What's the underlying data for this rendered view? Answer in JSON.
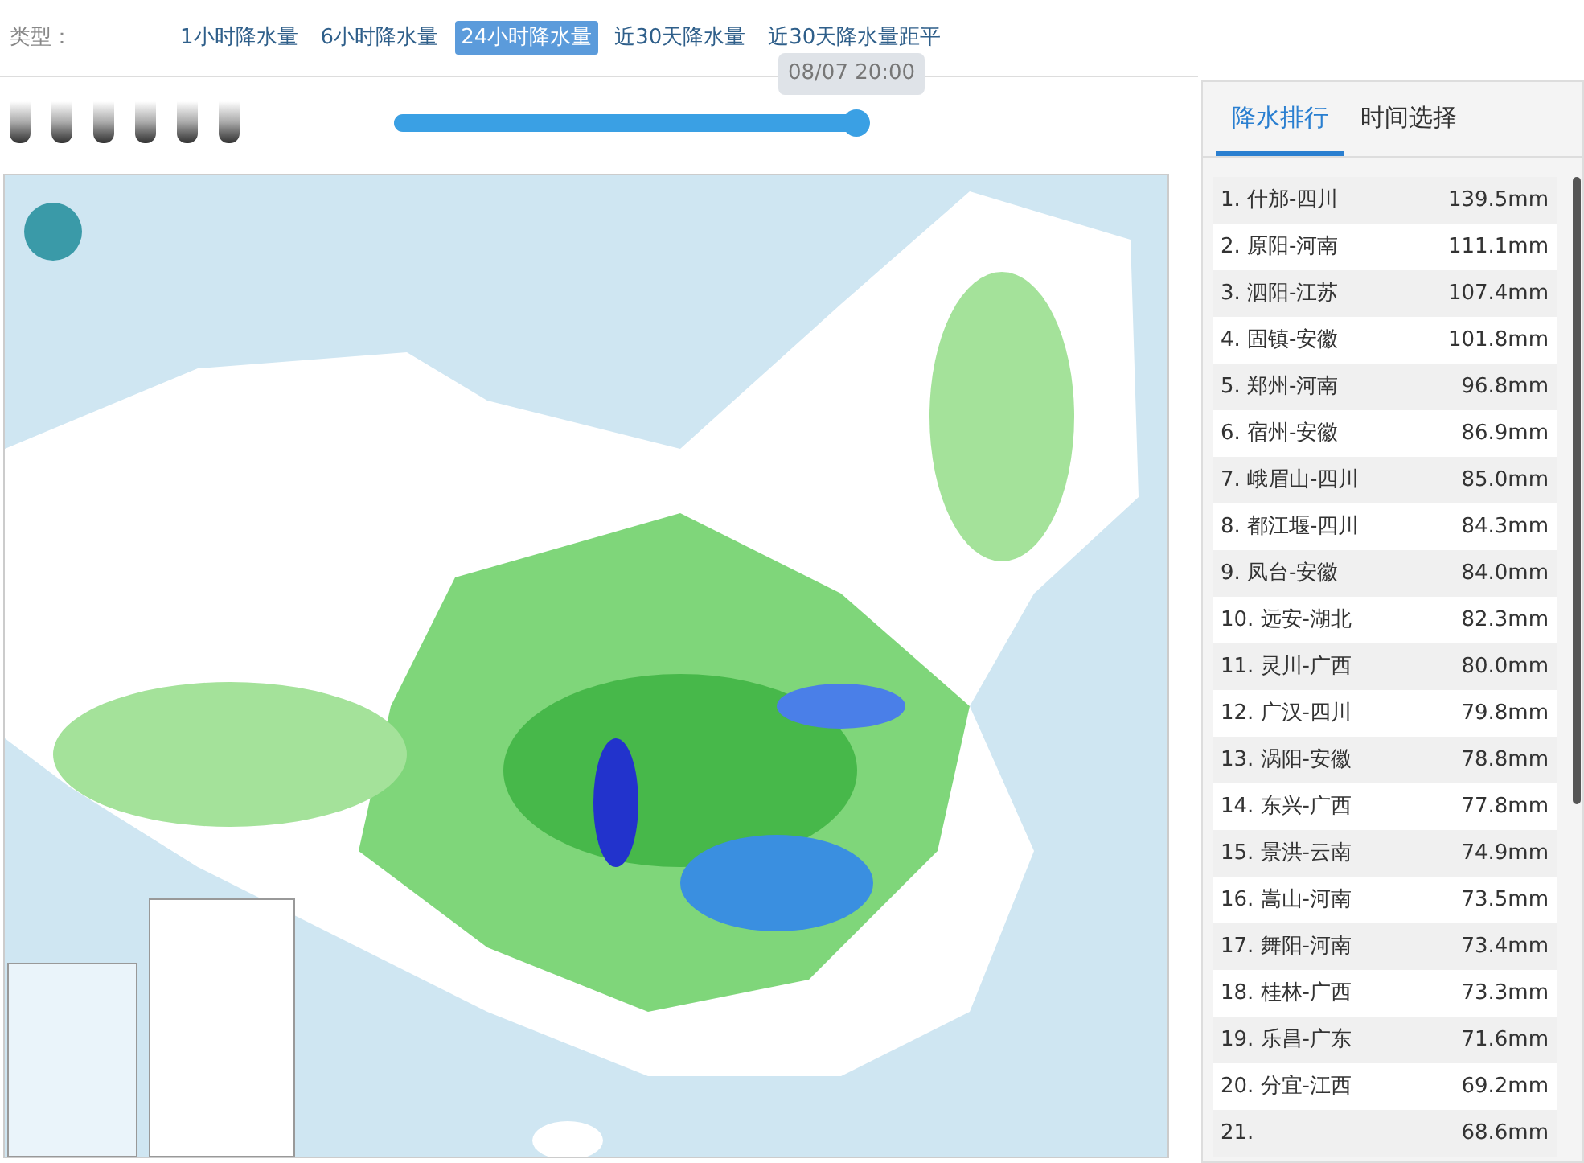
{
  "filter": {
    "label": "类型：",
    "tabs": [
      {
        "label": "1小时降水量",
        "selected": false
      },
      {
        "label": "6小时降水量",
        "selected": false
      },
      {
        "label": "24小时降水量",
        "selected": true
      },
      {
        "label": "近30天降水量",
        "selected": false
      },
      {
        "label": "近30天降水量距平",
        "selected": false
      }
    ]
  },
  "timeline": {
    "tooltip": "08/07 20:00",
    "level": 1
  },
  "panel": {
    "tabs": [
      {
        "label": "降水排行",
        "selected": true
      },
      {
        "label": "时间选择",
        "selected": false
      }
    ],
    "rows": [
      {
        "place": "1. 什邡-四川",
        "amount": "139.5mm"
      },
      {
        "place": "2. 原阳-河南",
        "amount": "111.1mm"
      },
      {
        "place": "3. 泗阳-江苏",
        "amount": "107.4mm"
      },
      {
        "place": "4. 固镇-安徽",
        "amount": "101.8mm"
      },
      {
        "place": "5. 郑州-河南",
        "amount": "96.8mm"
      },
      {
        "place": "6. 宿州-安徽",
        "amount": "86.9mm"
      },
      {
        "place": "7. 峨眉山-四川",
        "amount": "85.0mm"
      },
      {
        "place": "8. 都江堰-四川",
        "amount": "84.3mm"
      },
      {
        "place": "9. 凤台-安徽",
        "amount": "84.0mm"
      },
      {
        "place": "10. 远安-湖北",
        "amount": "82.3mm"
      },
      {
        "place": "11. 灵川-广西",
        "amount": "80.0mm"
      },
      {
        "place": "12. 广汉-四川",
        "amount": "79.8mm"
      },
      {
        "place": "13. 涡阳-安徽",
        "amount": "78.8mm"
      },
      {
        "place": "14. 东兴-广西",
        "amount": "77.8mm"
      },
      {
        "place": "15. 景洪-云南",
        "amount": "74.9mm"
      },
      {
        "place": "16. 嵩山-河南",
        "amount": "73.5mm"
      },
      {
        "place": "17. 舞阳-河南",
        "amount": "73.4mm"
      },
      {
        "place": "18. 桂林-广西",
        "amount": "73.3mm"
      },
      {
        "place": "19. 乐昌-广东",
        "amount": "71.6mm"
      },
      {
        "place": "20. 分宜-江西",
        "amount": "69.2mm"
      },
      {
        "place": "21.",
        "amount": "68.6mm"
      }
    ]
  }
}
